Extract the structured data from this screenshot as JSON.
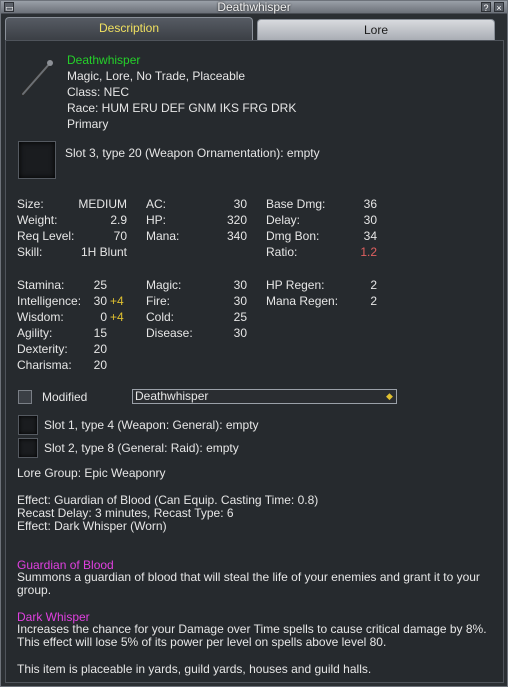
{
  "window": {
    "title": "Deathwhisper",
    "help_label": "?",
    "close_label": "×",
    "left_label": "▭"
  },
  "tabs": [
    {
      "label": "Description"
    },
    {
      "label": "Lore"
    }
  ],
  "item": {
    "name": "Deathwhisper",
    "flags": "Magic, Lore, No Trade, Placeable",
    "class": "Class: NEC",
    "race": "Race: HUM ERU DEF GNM IKS FRG DRK",
    "slot": "Primary",
    "ornament_slot": "Slot 3, type 20 (Weapon Ornamentation): empty"
  },
  "stats1": {
    "size_label": "Size:",
    "size_value": "MEDIUM",
    "weight_label": "Weight:",
    "weight_value": "2.9",
    "req_label": "Req Level:",
    "req_value": "70",
    "skill_label": "Skill:",
    "skill_value": "1H Blunt",
    "ac_label": "AC:",
    "ac_value": "30",
    "hp_label": "HP:",
    "hp_value": "320",
    "mana_label": "Mana:",
    "mana_value": "340",
    "dmg_label": "Base Dmg:",
    "dmg_value": "36",
    "delay_label": "Delay:",
    "delay_value": "30",
    "dmgbon_label": "Dmg Bon:",
    "dmgbon_value": "34",
    "ratio_label": "Ratio:",
    "ratio_value": "1.2"
  },
  "stats2": {
    "sta_label": "Stamina:",
    "sta_value": "25",
    "int_label": "Intelligence:",
    "int_value": "30",
    "int_bonus": "+4",
    "wis_label": "Wisdom:",
    "wis_value": "0",
    "wis_bonus": "+4",
    "agi_label": "Agility:",
    "agi_value": "15",
    "dex_label": "Dexterity:",
    "dex_value": "20",
    "cha_label": "Charisma:",
    "cha_value": "20",
    "magic_label": "Magic:",
    "magic_value": "30",
    "fire_label": "Fire:",
    "fire_value": "30",
    "cold_label": "Cold:",
    "cold_value": "25",
    "disease_label": "Disease:",
    "disease_value": "30",
    "hpregen_label": "HP Regen:",
    "hpregen_value": "2",
    "manaregen_label": "Mana Regen:",
    "manaregen_value": "2"
  },
  "modified": {
    "label": "Modified",
    "selected": "Deathwhisper",
    "arrow": "◆"
  },
  "aug_slots": [
    "Slot 1, type 4 (Weapon: General): empty",
    "Slot 2, type 8 (General: Raid): empty"
  ],
  "lore_group": "Lore Group: Epic Weaponry",
  "effects": {
    "line1": "Effect: Guardian of Blood (Can Equip. Casting Time: 0.8)",
    "line2": "Recast Delay: 3 minutes, Recast Type: 6",
    "line3": "Effect: Dark Whisper (Worn)"
  },
  "spell1": {
    "name": "Guardian of Blood",
    "text": "Summons a guardian of blood that will steal the life of your enemies and grant it to your group."
  },
  "spell2": {
    "name": "Dark Whisper",
    "text": "Increases the chance for your Damage over Time spells to cause critical damage by 8%. This effect will lose 5% of its power per level on spells above level 80."
  },
  "placeable_note": "This item is placeable in yards, guild yards, houses and guild halls.",
  "colors": {
    "item_name": "#25d02a",
    "spell_name": "#e040e0",
    "bonus": "#e0c030",
    "ratio": "#e06060"
  }
}
